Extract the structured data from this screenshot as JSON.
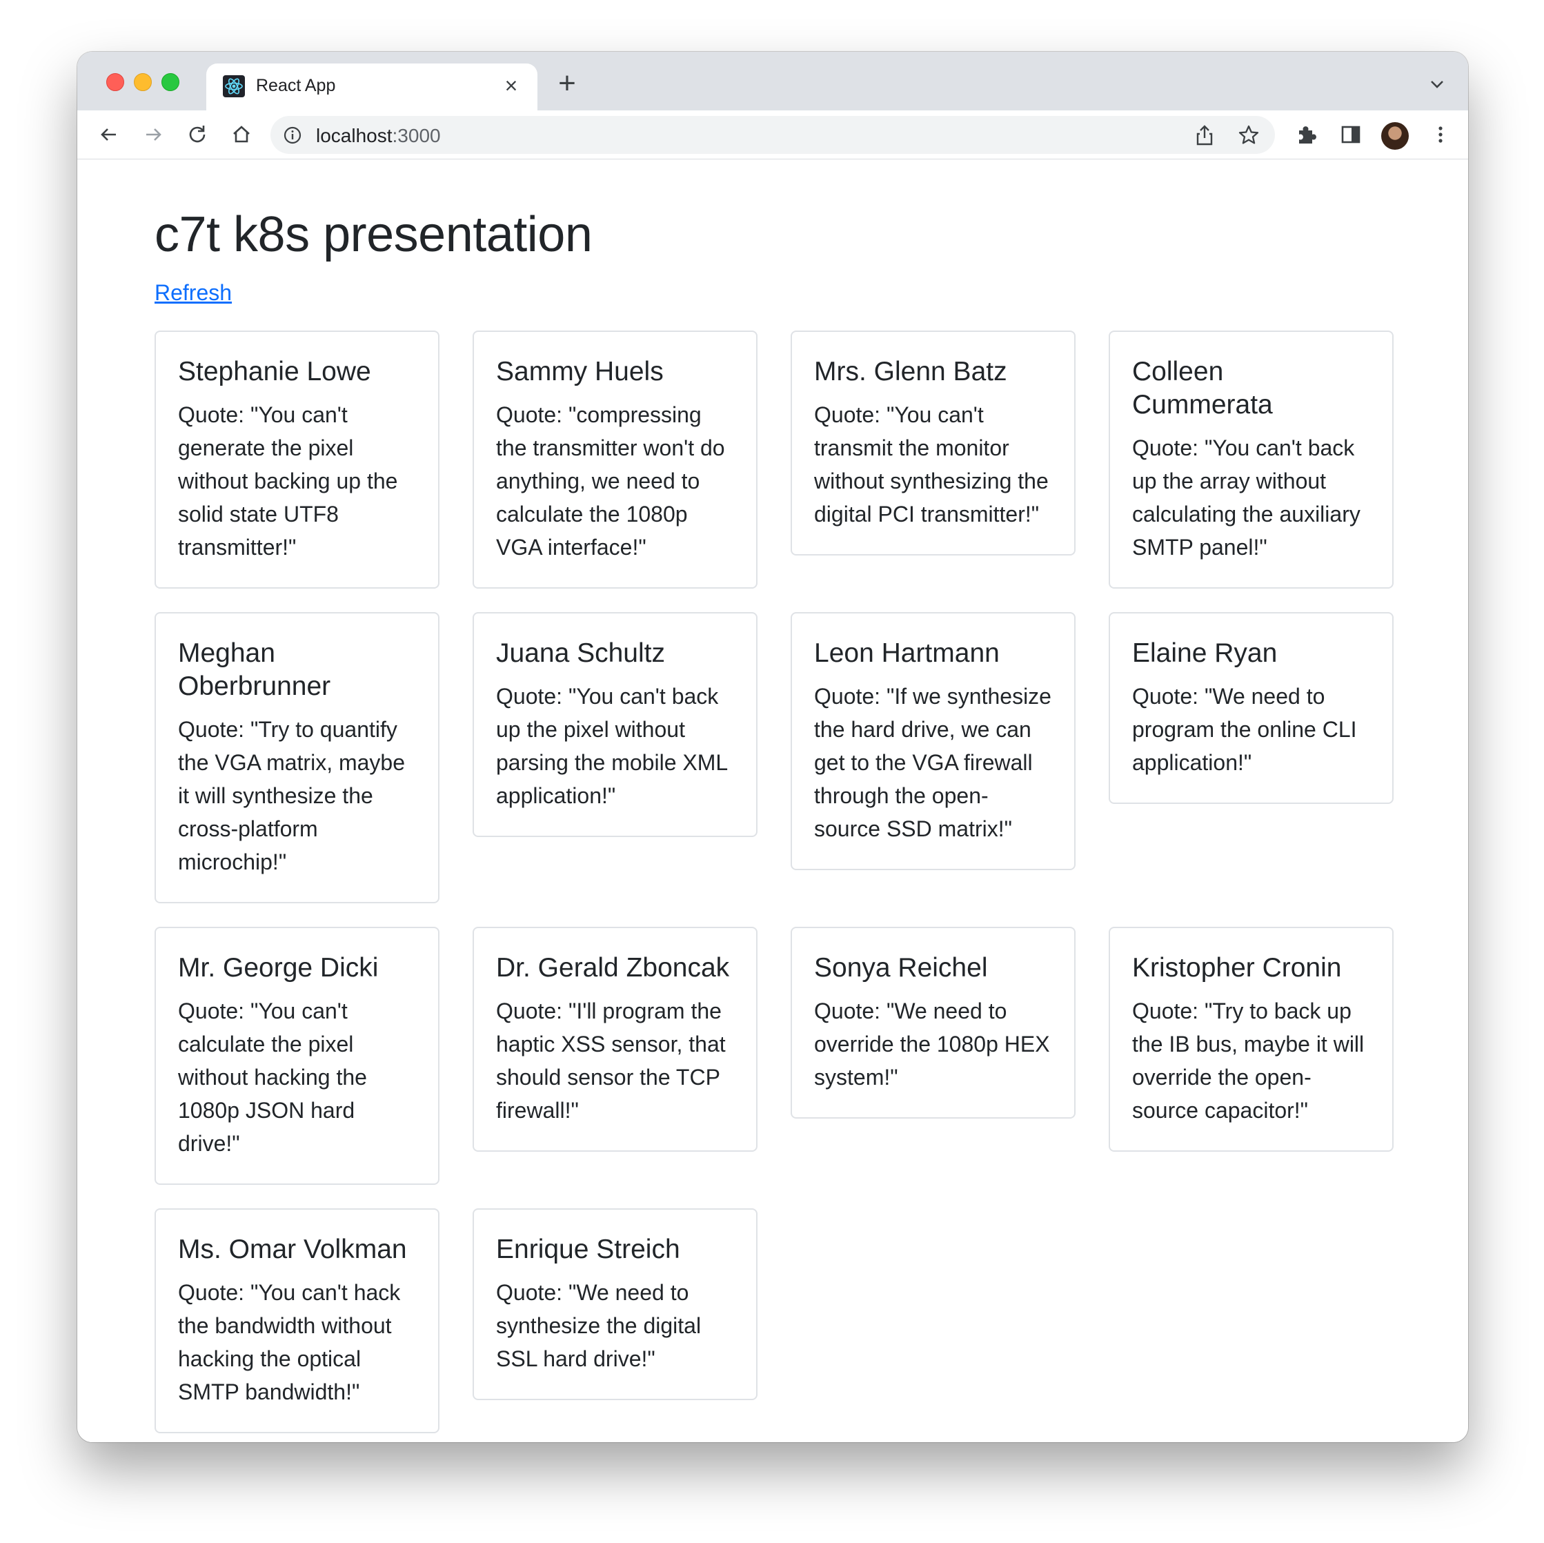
{
  "browser": {
    "tab_title": "React App",
    "url_host": "localhost",
    "url_port": ":3000"
  },
  "page": {
    "title": "c7t k8s presentation",
    "refresh_label": "Refresh"
  },
  "cards": [
    {
      "name": "Stephanie Lowe",
      "quote": "Quote: \"You can't generate the pixel without backing up the solid state UTF8 transmitter!\""
    },
    {
      "name": "Sammy Huels",
      "quote": "Quote: \"compressing the transmitter won't do anything, we need to calculate the 1080p VGA interface!\""
    },
    {
      "name": "Mrs. Glenn Batz",
      "quote": "Quote: \"You can't transmit the monitor without synthesizing the digital PCI transmitter!\""
    },
    {
      "name": "Colleen Cummerata",
      "quote": "Quote: \"You can't back up the array without calculating the auxiliary SMTP panel!\""
    },
    {
      "name": "Meghan Oberbrunner",
      "quote": "Quote: \"Try to quantify the VGA matrix, maybe it will synthesize the cross-platform microchip!\""
    },
    {
      "name": "Juana Schultz",
      "quote": "Quote: \"You can't back up the pixel without parsing the mobile XML application!\""
    },
    {
      "name": "Leon Hartmann",
      "quote": "Quote: \"If we synthesize the hard drive, we can get to the VGA firewall through the open-source SSD matrix!\""
    },
    {
      "name": "Elaine Ryan",
      "quote": "Quote: \"We need to program the online CLI application!\""
    },
    {
      "name": "Mr. George Dicki",
      "quote": "Quote: \"You can't calculate the pixel without hacking the 1080p JSON hard drive!\""
    },
    {
      "name": "Dr. Gerald Zboncak",
      "quote": "Quote: \"I'll program the haptic XSS sensor, that should sensor the TCP firewall!\""
    },
    {
      "name": "Sonya Reichel",
      "quote": "Quote: \"We need to override the 1080p HEX system!\""
    },
    {
      "name": "Kristopher Cronin",
      "quote": "Quote: \"Try to back up the IB bus, maybe it will override the open-source capacitor!\""
    },
    {
      "name": "Ms. Omar Volkman",
      "quote": "Quote: \"You can't hack the bandwidth without hacking the optical SMTP bandwidth!\""
    },
    {
      "name": "Enrique Streich",
      "quote": "Quote: \"We need to synthesize the digital SSL hard drive!\""
    }
  ]
}
